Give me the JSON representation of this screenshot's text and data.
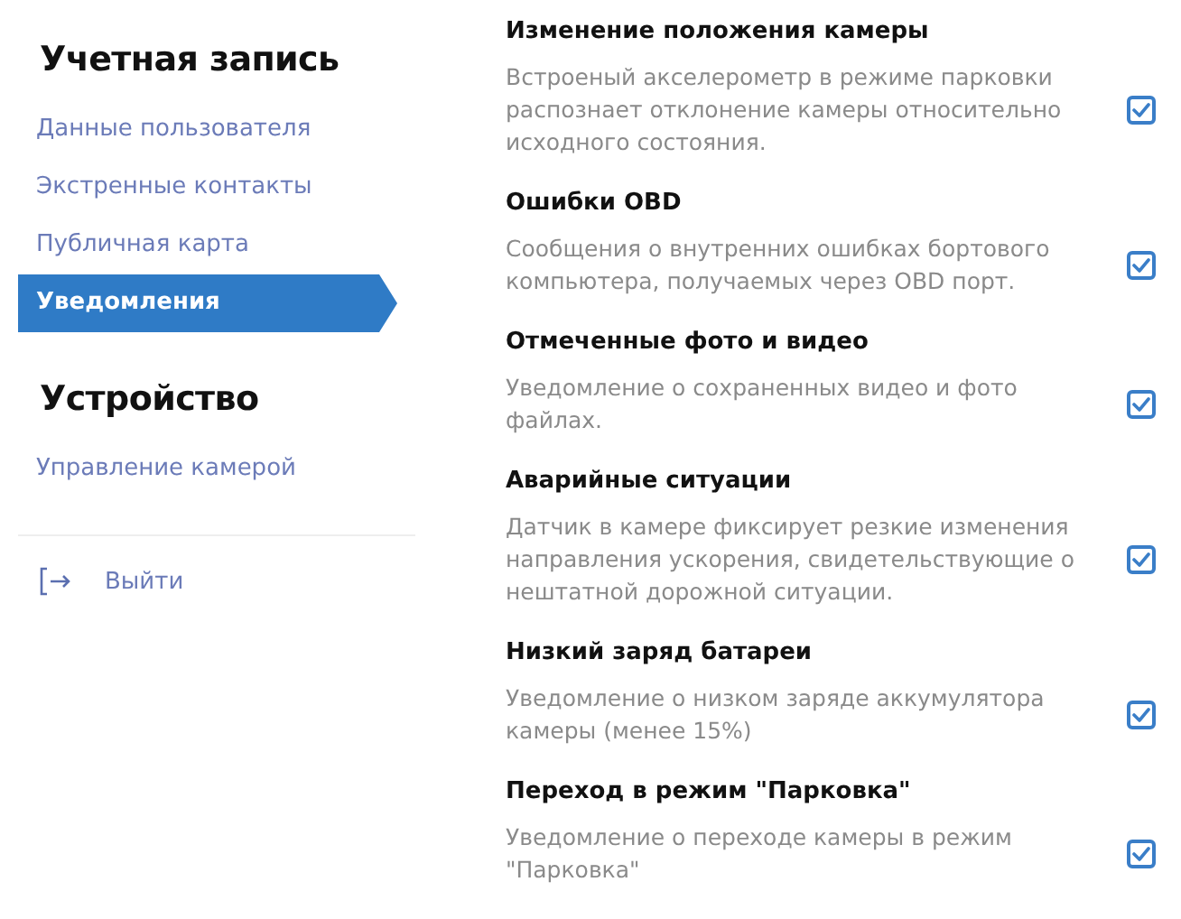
{
  "sidebar": {
    "sections": [
      {
        "title": "Учетная запись",
        "items": [
          {
            "label": "Данные пользователя",
            "selected": false
          },
          {
            "label": "Экстренные контакты",
            "selected": false
          },
          {
            "label": "Публичная карта",
            "selected": false
          },
          {
            "label": "Уведомления",
            "selected": true
          }
        ]
      },
      {
        "title": "Устройство",
        "items": [
          {
            "label": "Управление камерой",
            "selected": false
          }
        ]
      }
    ],
    "logout": "Выйти"
  },
  "notifications": [
    {
      "title": "Изменение положения камеры",
      "description": "Встроеный акселерометр в режиме парковки распознает отклонение камеры относительно исходного состояния.",
      "checked": true
    },
    {
      "title": "Ошибки OBD",
      "description": "Сообщения о внутренних ошибках бортового компьютера, получаемых через OBD порт.",
      "checked": true
    },
    {
      "title": "Отмеченные фото и видео",
      "description": "Уведомление о сохраненных видео и фото файлах.",
      "checked": true
    },
    {
      "title": "Аварийные ситуации",
      "description": "Датчик в камере фиксирует резкие изменения направления ускорения, свидетельствующие о нештатной дорожной ситуации.",
      "checked": true
    },
    {
      "title": "Низкий заряд батареи",
      "description": "Уведомление о низком заряде аккумулятора камеры (менее 15%)",
      "checked": true
    },
    {
      "title": "Переход в режим \"Парковка\"",
      "description": "Уведомление о переходе камеры в режим \"Парковка\"",
      "checked": true
    }
  ]
}
